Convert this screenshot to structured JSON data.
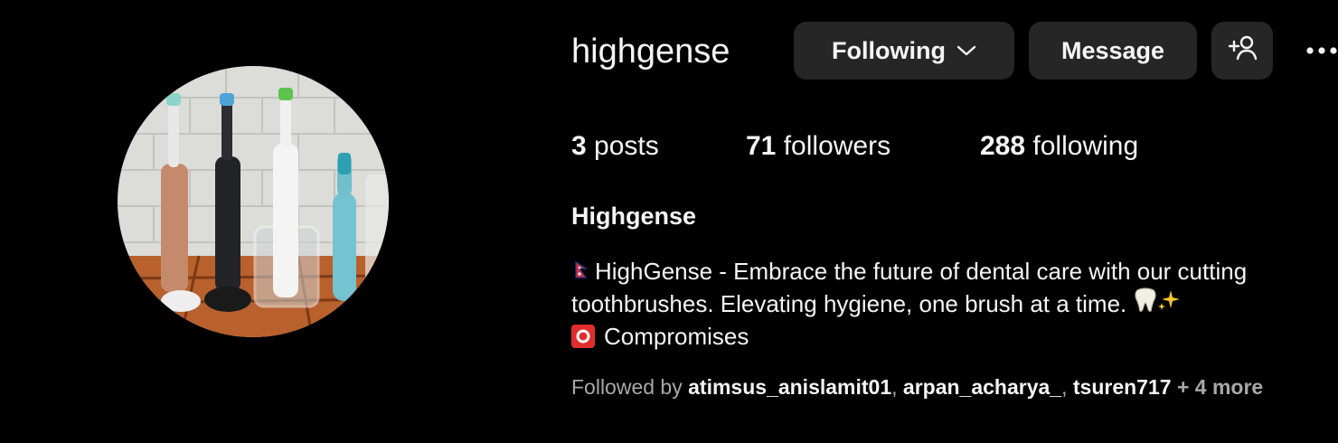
{
  "profile": {
    "username": "highgense",
    "full_name": "Highgense",
    "avatar_alt": "toothbrushes photo"
  },
  "actions": {
    "following_label": "Following",
    "message_label": "Message",
    "add_user_icon": "add-person-icon",
    "more_icon": "more-options-icon"
  },
  "stats": {
    "posts_count": "3",
    "posts_label": "posts",
    "followers_count": "71",
    "followers_label": "followers",
    "following_count": "288",
    "following_label": "following"
  },
  "bio": {
    "line1": "HighGense - Embrace the future of dental care with our cutting",
    "line2": "toothbrushes. Elevating hygiene, one brush at a time.",
    "line3": "Compromises",
    "line1_emoji": "nepal-flag",
    "line2_emoji": "tooth-sparkles",
    "line3_emoji": "o-button"
  },
  "followed_by": {
    "prefix": "Followed by",
    "users": [
      "atimsus_anislamit01",
      "arpan_acharya_",
      "tsuren717"
    ],
    "more": "+ 4 more"
  },
  "colors": {
    "background": "#000000",
    "button_bg": "#262626",
    "text_primary": "#f5f5f5",
    "text_secondary": "#a8a8a8",
    "badge_red": "#e02d2d"
  }
}
